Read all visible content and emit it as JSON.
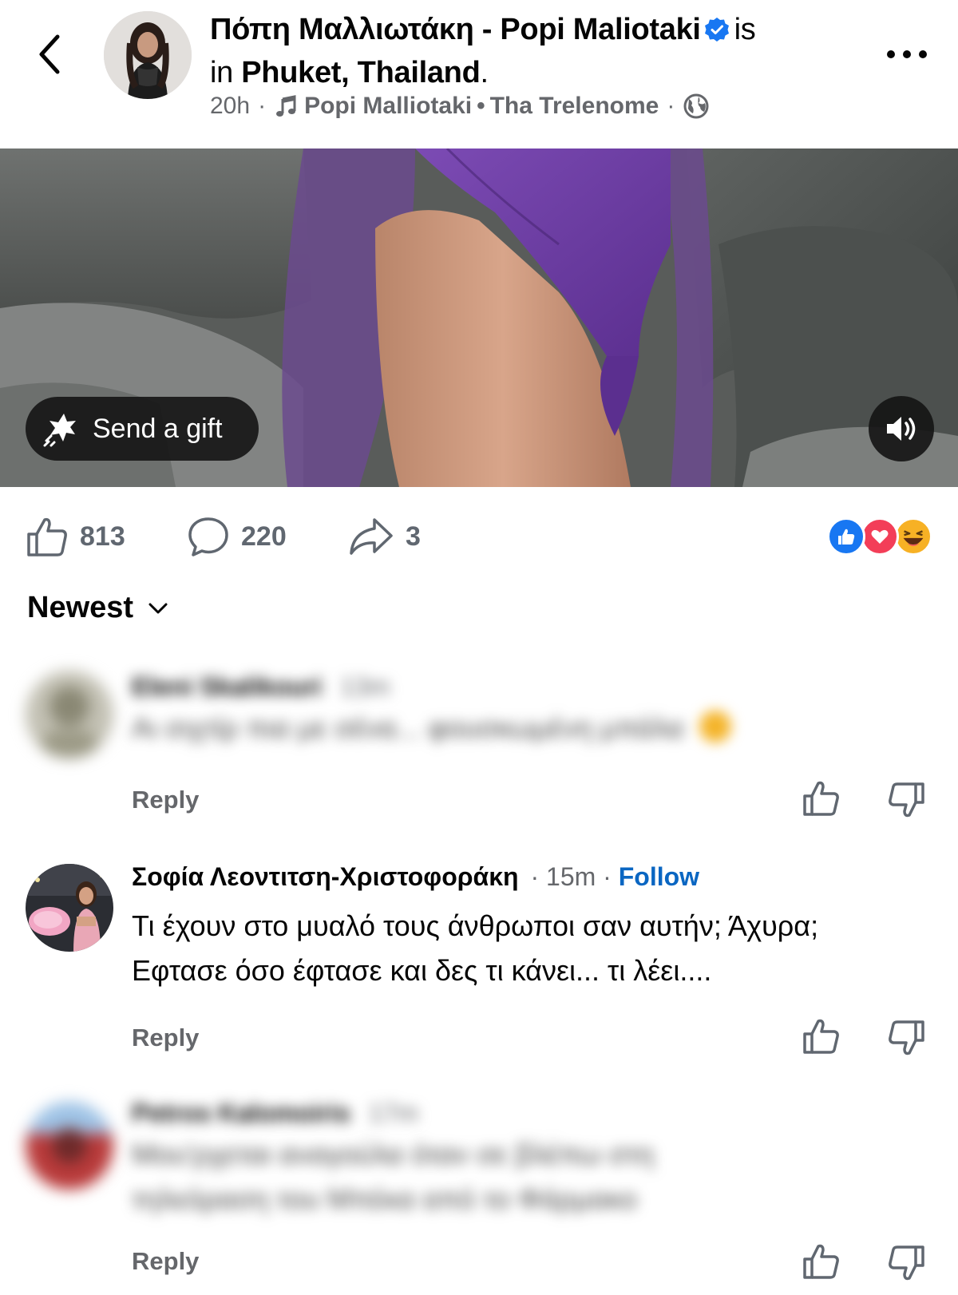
{
  "header": {
    "author": "Πόπη Μαλλιωτάκη - Popi Maliotaki",
    "is_text": "is",
    "in_text": "in",
    "location": "Phuket, Thailand",
    "period": ".",
    "time": "20h",
    "dot": "·",
    "music_artist": "Popi Malliotaki",
    "music_sep": "•",
    "music_title": "Tha Trelenome",
    "dot2": "·"
  },
  "media": {
    "gift_label": "Send a gift"
  },
  "actions": {
    "likes": "813",
    "comments": "220",
    "shares": "3"
  },
  "sort": {
    "label": "Newest"
  },
  "comments": [
    {
      "name": "Eleni Skalikouri",
      "time": "13m",
      "text": "Αι σιχτίρ πια με σένα... φουσκωμένη μπάλα",
      "reply": "Reply",
      "blurred": true
    },
    {
      "name": "Σοφία Λεοντιτση-Χριστοφοράκη",
      "time": "15m",
      "dot": "·",
      "follow": "Follow",
      "text_line1": "Τι έχουν στο μυαλό τους άνθρωποι σαν αυτήν; Άχυρα;",
      "text_line2": "Εφτασε όσο έφτασε και δες τι κάνει... τι λέει....",
      "reply": "Reply",
      "blurred": false
    },
    {
      "name": "Petros Kalomoiris",
      "time": "17m",
      "text_line1": "Μου'ρχεται αναγούλα όταν σε βλέπω στη",
      "text_line2": "τηλεόραση του Μπέκα από το Φάρμακο",
      "reply": "Reply",
      "blurred": true
    }
  ],
  "colors": {
    "accent_blue": "#0a66c2",
    "verified_blue": "#1877f2",
    "muted": "#65676b",
    "swimsuit": "#6b3fa0"
  },
  "icons": [
    "back-icon",
    "verified-icon",
    "music-icon",
    "globe-icon",
    "more-icon",
    "gift-icon",
    "sound-icon",
    "like-icon",
    "comment-icon",
    "share-icon",
    "like-reaction-icon",
    "love-reaction-icon",
    "haha-reaction-icon",
    "chevron-down-icon",
    "upvote-icon",
    "downvote-icon"
  ]
}
